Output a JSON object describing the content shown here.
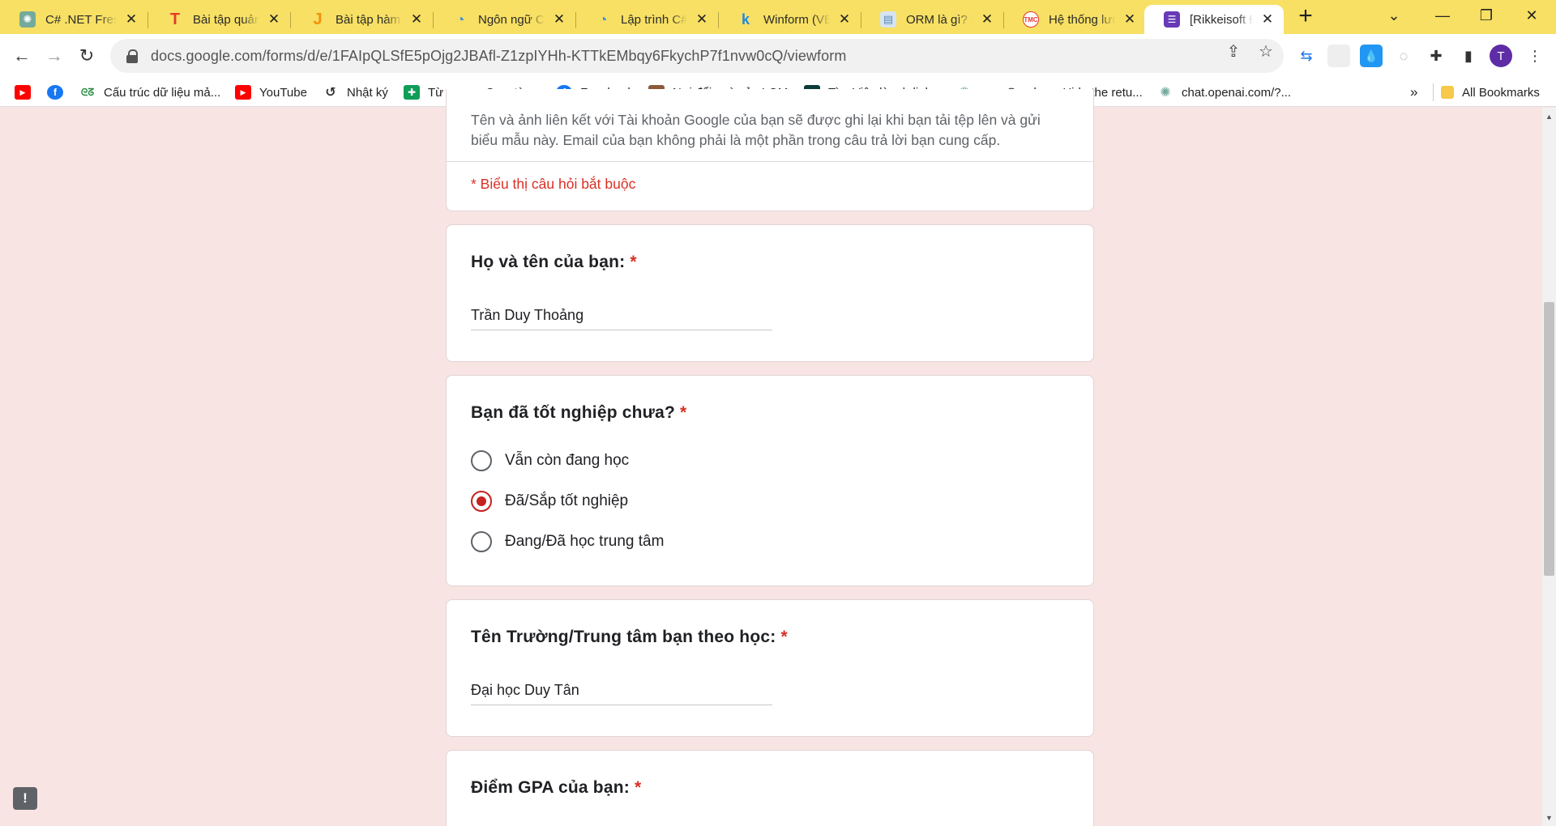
{
  "browser": {
    "tabs": [
      {
        "title": "C# .NET Fresher",
        "favicon": "openai-icon",
        "color": "#74aa9c"
      },
      {
        "title": "Bài tập quản lý",
        "favicon": "t-logo-icon",
        "color": "#e8382c"
      },
      {
        "title": "Bài tập hàm trong",
        "favicon": "j-logo-icon",
        "color": "#f4900c"
      },
      {
        "title": "Ngôn ngữ C# là gì",
        "favicon": "c-logo-icon",
        "color": "#4a90d9"
      },
      {
        "title": "Lập trình C# - Tìm",
        "favicon": "c-logo-icon",
        "color": "#4a90d9"
      },
      {
        "title": "Winform (VB.NET",
        "favicon": "k-logo-icon",
        "color": "#1e88e5"
      },
      {
        "title": "ORM là gì? Kiến",
        "favicon": "books-icon",
        "color": "#8bb2d6"
      },
      {
        "title": "Hệ thống lưu trữ",
        "favicon": "tmc-logo-icon",
        "color": "#e53935"
      },
      {
        "title": "[Rikkeisoft Đà Nẵng",
        "favicon": "google-forms-icon",
        "color": "#673ab7"
      }
    ],
    "new_tab_label": "+",
    "url": "docs.google.com/forms/d/e/1FAIpQLSfE5pOjg2JBAfl-Z1zpIYHh-KTTkEMbqy6FkychP7f1nvw0cQ/viewform",
    "profile_initial": "T",
    "bookmarks": [
      {
        "label": "",
        "icon": "youtube-icon"
      },
      {
        "label": "",
        "icon": "facebook-icon"
      },
      {
        "label": "Cấu trúc dữ liệu mả...",
        "icon": "geeksforgeeks-icon"
      },
      {
        "label": "YouTube",
        "icon": "youtube-icon"
      },
      {
        "label": "Nhật ký",
        "icon": "history-icon"
      },
      {
        "label": "Từ vựng - Cụm từ -...",
        "icon": "sheets-icon"
      },
      {
        "label": "Facebook",
        "icon": "facebook-icon"
      },
      {
        "label": "Nơi đổi quà của LQM",
        "icon": "game-icon"
      },
      {
        "label": "Tìm Việc làm | dinh...",
        "icon": "job-icon"
      },
      {
        "label": "x",
        "icon": "openai-icon"
      },
      {
        "label": "close: Hide the retu...",
        "icon": "globe-icon"
      },
      {
        "label": "chat.openai.com/?...",
        "icon": "openai-icon"
      }
    ],
    "bookmarks_overflow": "»",
    "all_bookmarks_label": "All Bookmarks"
  },
  "form": {
    "account_notice_line1": "Tên và ảnh liên kết với Tài khoản Google của bạn sẽ được ghi lại khi bạn tải tệp lên và gửi",
    "account_notice_line2": "biểu mẫu này. Email của bạn không phải là một phần trong câu trả lời bạn cung cấp.",
    "required_notice": "* Biểu thị câu hỏi bắt buộc",
    "required_marker": "*",
    "q_name": {
      "title": "Họ và tên của bạn:",
      "answer": "Trần Duy Thoảng"
    },
    "q_graduated": {
      "title": "Bạn đã tốt nghiệp chưa?",
      "options": [
        "Vẫn còn đang học",
        "Đã/Sắp tốt nghiệp",
        "Đang/Đã học trung tâm"
      ],
      "selected_index": 1
    },
    "q_school": {
      "title": "Tên Trường/Trung tâm bạn theo học:",
      "answer": "Đại học Duy Tân"
    },
    "q_gpa": {
      "title": "Điểm GPA của bạn:"
    }
  },
  "colors": {
    "accent": "#c5221f",
    "required": "#d93025",
    "page_bg": "#f9e4e4",
    "tab_strip": "#f7e063"
  }
}
